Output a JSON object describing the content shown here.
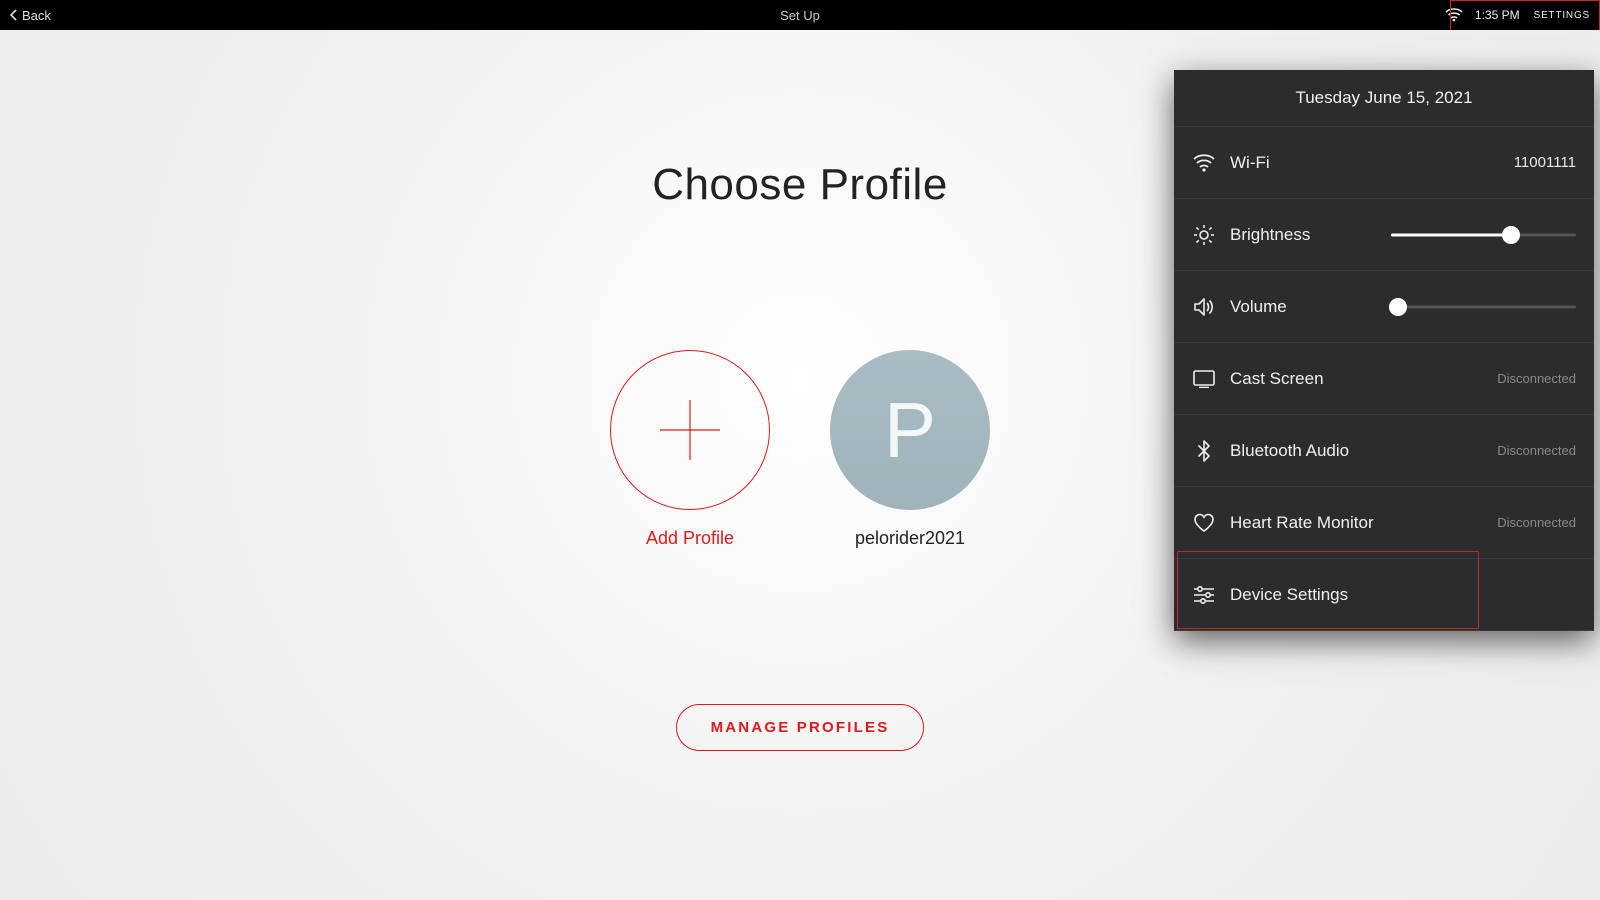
{
  "topbar": {
    "back_label": "Back",
    "title": "Set Up",
    "clock": "1:35 PM",
    "settings_label": "SETTINGS"
  },
  "main": {
    "heading": "Choose Profile",
    "add_profile_label": "Add Profile",
    "profiles": [
      {
        "name": "pelorider2021",
        "initial": "P"
      }
    ],
    "manage_label": "MANAGE PROFILES"
  },
  "panel": {
    "date": "Tuesday June 15, 2021",
    "wifi": {
      "label": "Wi-Fi",
      "value": "11001111"
    },
    "brightness": {
      "label": "Brightness",
      "percent": 65
    },
    "volume": {
      "label": "Volume",
      "percent": 4
    },
    "cast": {
      "label": "Cast Screen",
      "status": "Disconnected"
    },
    "bluetooth": {
      "label": "Bluetooth Audio",
      "status": "Disconnected"
    },
    "hrm": {
      "label": "Heart Rate Monitor",
      "status": "Disconnected"
    },
    "device": {
      "label": "Device Settings"
    }
  },
  "colors": {
    "accent": "#e1191a"
  }
}
